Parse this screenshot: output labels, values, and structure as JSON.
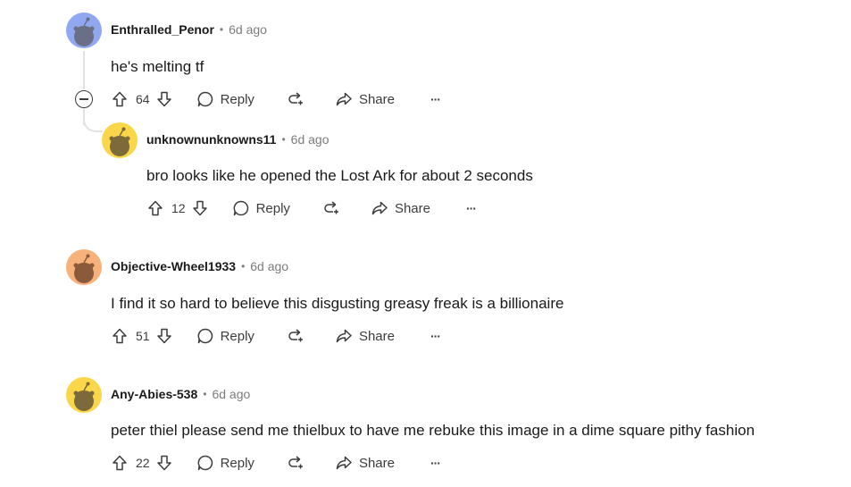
{
  "colors": {
    "avatar_blue": "#8fa8f0",
    "avatar_yellow": "#f9d64a",
    "avatar_orange": "#f7b17a",
    "snoo": "#7d6a3a"
  },
  "comments": [
    {
      "username": "Enthralled_Penor",
      "separator": "•",
      "time": "6d ago",
      "text": "he's melting tf",
      "score": "64",
      "reply_label": "Reply",
      "share_label": "Share",
      "more_label": "···",
      "avatar_color": "blue"
    },
    {
      "username": "unknownunknowns11",
      "separator": "•",
      "time": "6d ago",
      "text": "bro looks like he opened the Lost Ark for about 2 seconds",
      "score": "12",
      "reply_label": "Reply",
      "share_label": "Share",
      "more_label": "···",
      "avatar_color": "yellow"
    },
    {
      "username": "Objective-Wheel1933",
      "separator": "•",
      "time": "6d ago",
      "text": "I find it so hard to believe this disgusting greasy freak is a billionaire",
      "score": "51",
      "reply_label": "Reply",
      "share_label": "Share",
      "more_label": "···",
      "avatar_color": "orange"
    },
    {
      "username": "Any-Abies-538",
      "separator": "•",
      "time": "6d ago",
      "text": "peter thiel please send me thielbux to have me rebuke this image in a dime square pithy fashion",
      "score": "22",
      "reply_label": "Reply",
      "share_label": "Share",
      "more_label": "···",
      "avatar_color": "yellow"
    }
  ]
}
